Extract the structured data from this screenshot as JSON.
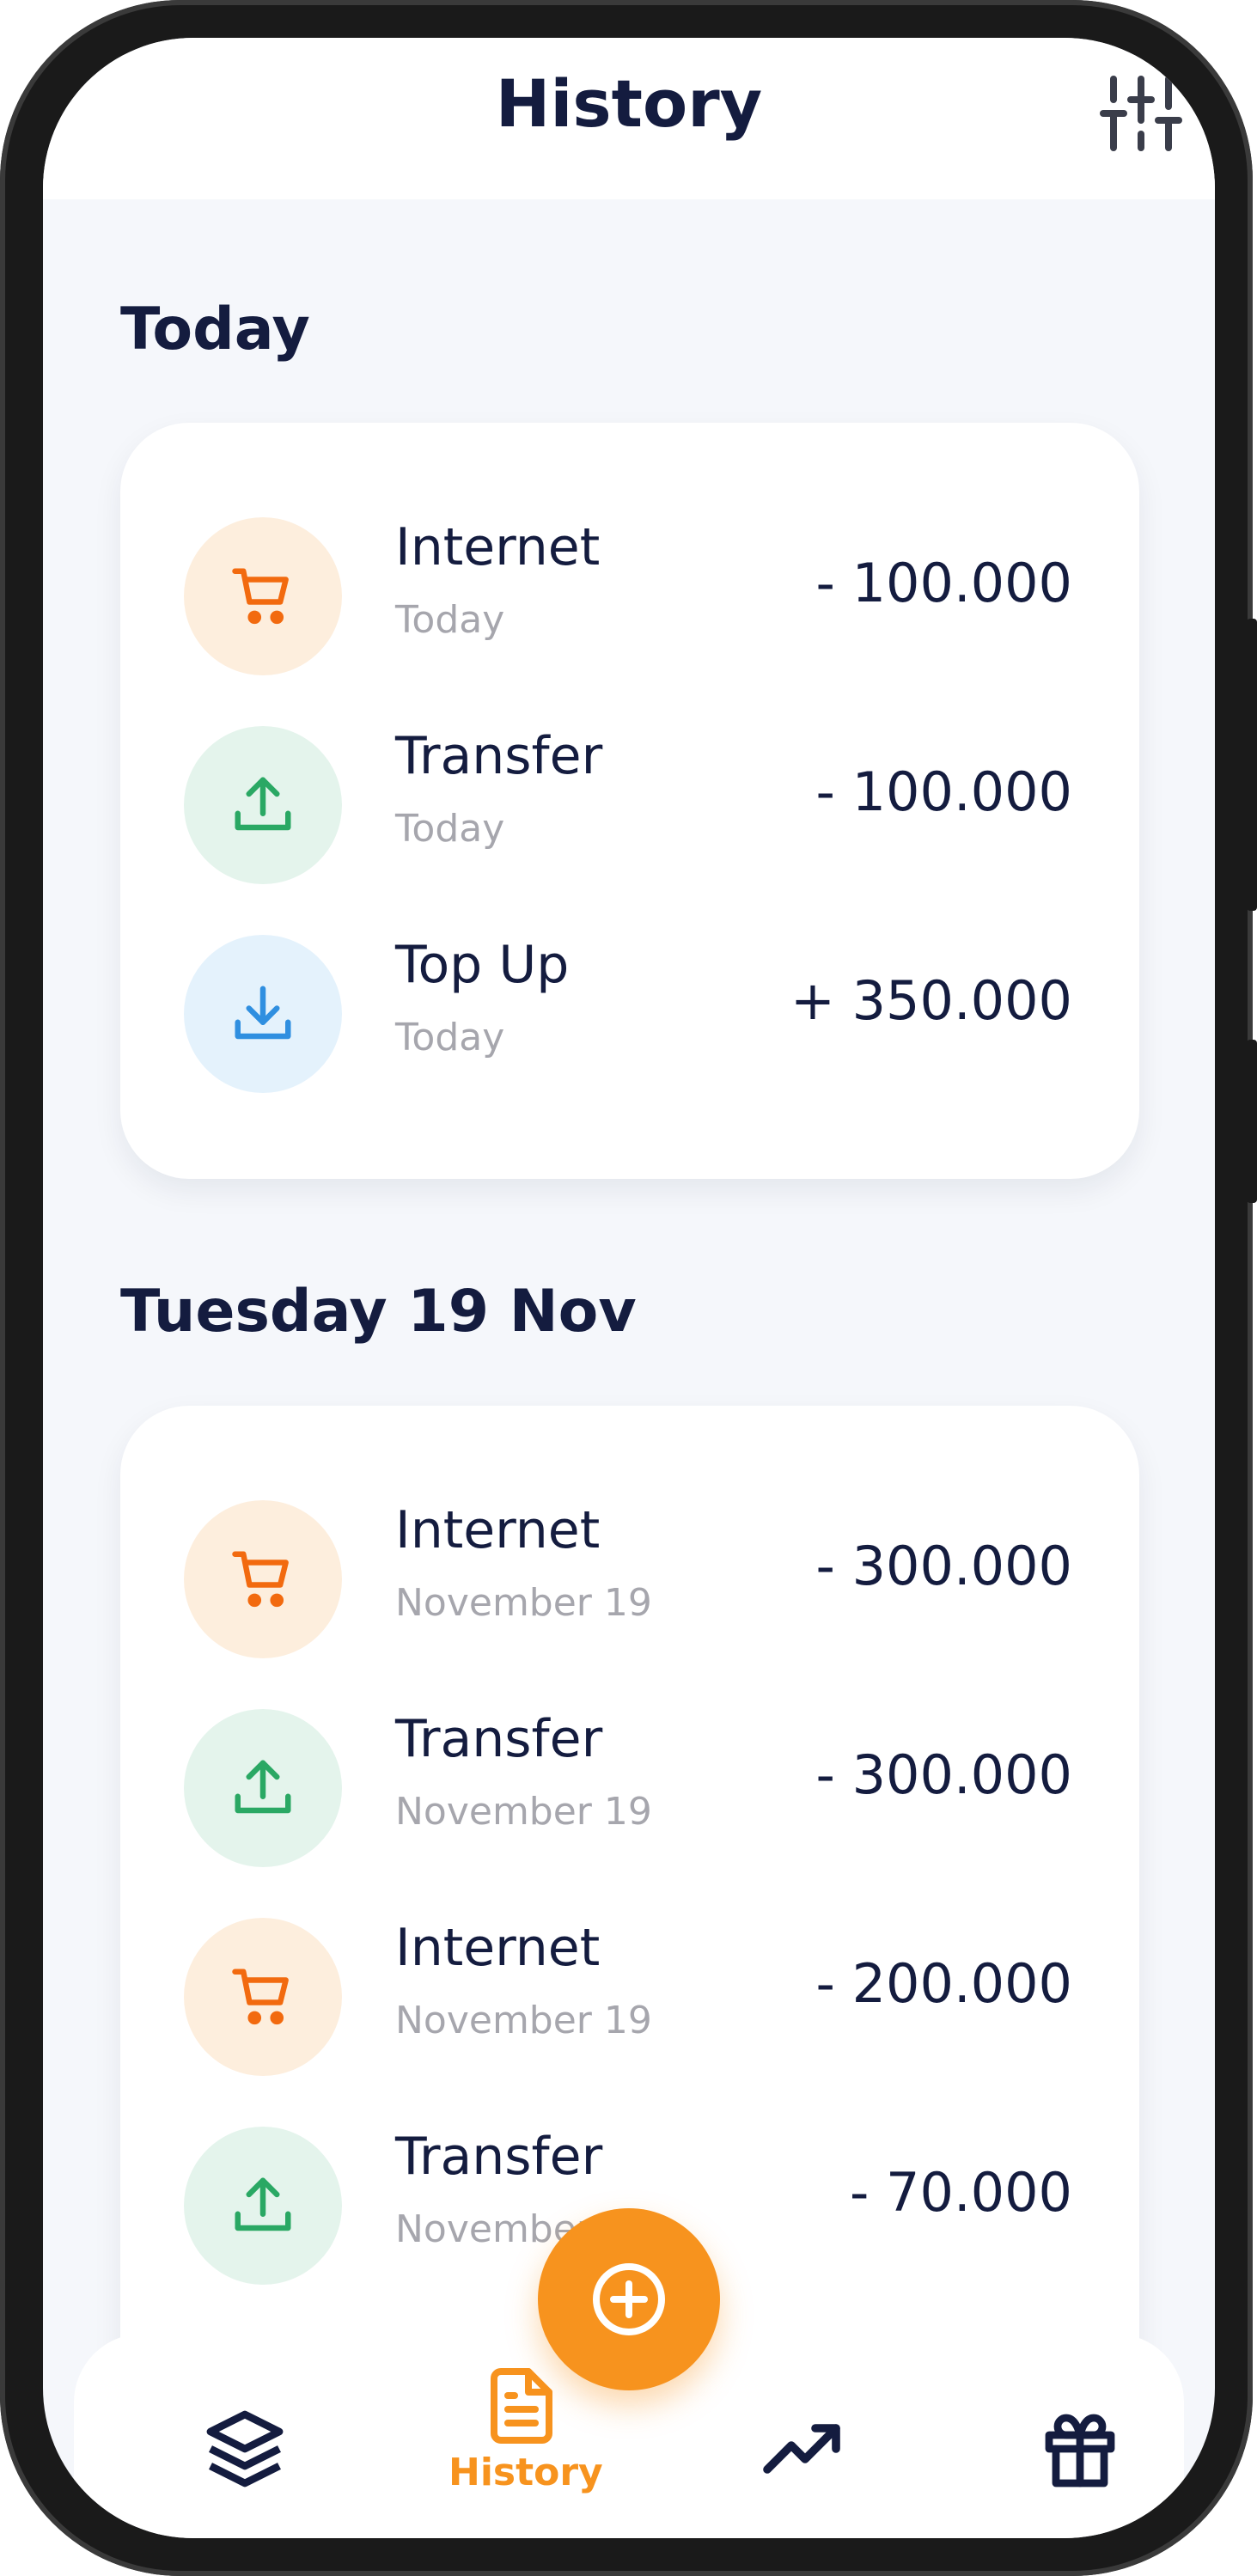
{
  "header": {
    "title": "History",
    "filter_icon": "sliders-icon"
  },
  "sections": [
    {
      "title": "Today",
      "items": [
        {
          "name": "Internet",
          "date": "Today",
          "amount": "- 100.000",
          "icon": "cart-icon",
          "tone": "orange"
        },
        {
          "name": "Transfer",
          "date": "Today",
          "amount": "- 100.000",
          "icon": "upload-icon",
          "tone": "green"
        },
        {
          "name": "Top Up",
          "date": "Today",
          "amount": "+ 350.000",
          "icon": "download-icon",
          "tone": "blue"
        }
      ]
    },
    {
      "title": "Tuesday 19 Nov",
      "items": [
        {
          "name": "Internet",
          "date": "November 19",
          "amount": "- 300.000",
          "icon": "cart-icon",
          "tone": "orange"
        },
        {
          "name": "Transfer",
          "date": "November 19",
          "amount": "- 300.000",
          "icon": "upload-icon",
          "tone": "green"
        },
        {
          "name": "Internet",
          "date": "November 19",
          "amount": "- 200.000",
          "icon": "cart-icon",
          "tone": "orange"
        },
        {
          "name": "Transfer",
          "date": "November 19",
          "amount": "- 70.000",
          "icon": "upload-icon",
          "tone": "green"
        }
      ]
    }
  ],
  "nav": {
    "items": [
      {
        "icon": "layers-icon",
        "label": ""
      },
      {
        "icon": "document-icon",
        "label": "History",
        "active": true
      },
      {
        "icon": "trending-up-icon",
        "label": ""
      },
      {
        "icon": "gift-icon",
        "label": ""
      }
    ],
    "fab_icon": "plus-circle-icon"
  },
  "colors": {
    "accent": "#f7931e",
    "text_dark": "#141c3f",
    "text_muted": "#a6a6ad",
    "background": "#f5f7fb",
    "orange_bg": "#fdeedd",
    "green_bg": "#e4f4ec",
    "blue_bg": "#e4f2fc"
  }
}
